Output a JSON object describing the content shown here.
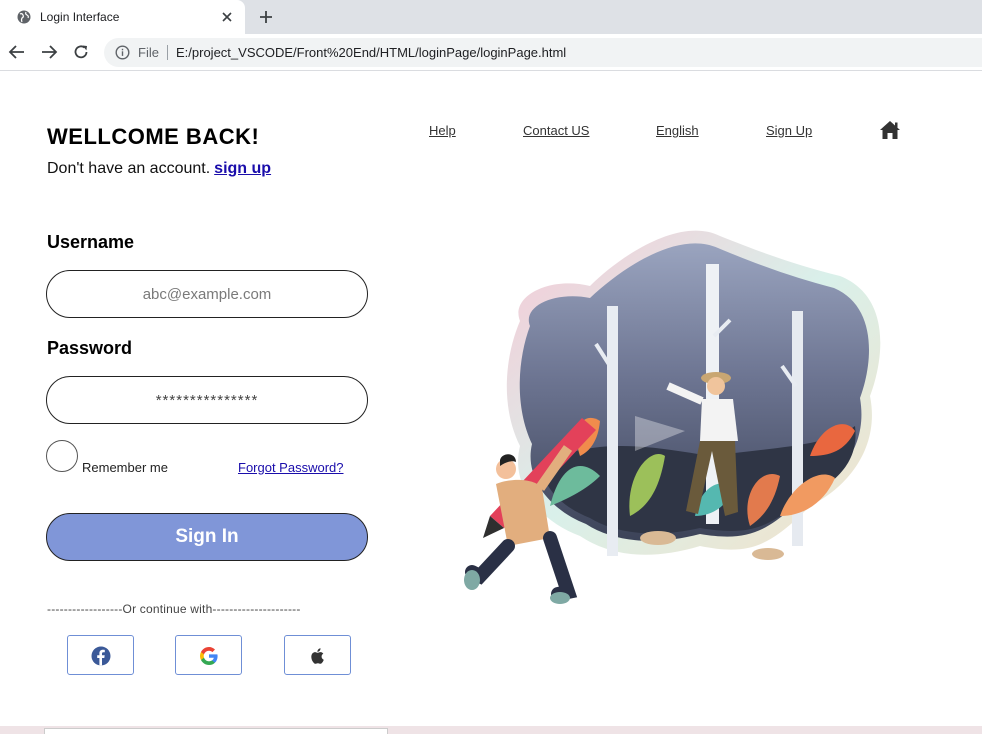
{
  "browser": {
    "tab_title": "Login Interface",
    "file_label": "File",
    "url": "E:/project_VSCODE/Front%20End/HTML/loginPage/loginPage.html"
  },
  "header": {
    "title": "WELLCOME BACK!",
    "subtitle": "Don't have an account.",
    "signup_link": "sign up"
  },
  "nav": {
    "items": [
      "Help",
      "Contact US",
      "English",
      "Sign Up"
    ],
    "home_icon": "home-icon"
  },
  "form": {
    "username_label": "Username",
    "username_placeholder": "abc@example.com",
    "password_label": "Password",
    "password_value": "***************",
    "remember_label": "Remember me",
    "forgot_link": "Forgot Password?",
    "signin_label": "Sign In",
    "continue_text": "------------------Or continue with---------------------"
  },
  "social": [
    {
      "icon": "facebook-icon"
    },
    {
      "icon": "google-icon"
    },
    {
      "icon": "apple-icon"
    }
  ],
  "colors": {
    "accent": "#8096d8",
    "link": "#1a0dab",
    "social_border": "#6f8fd6"
  }
}
